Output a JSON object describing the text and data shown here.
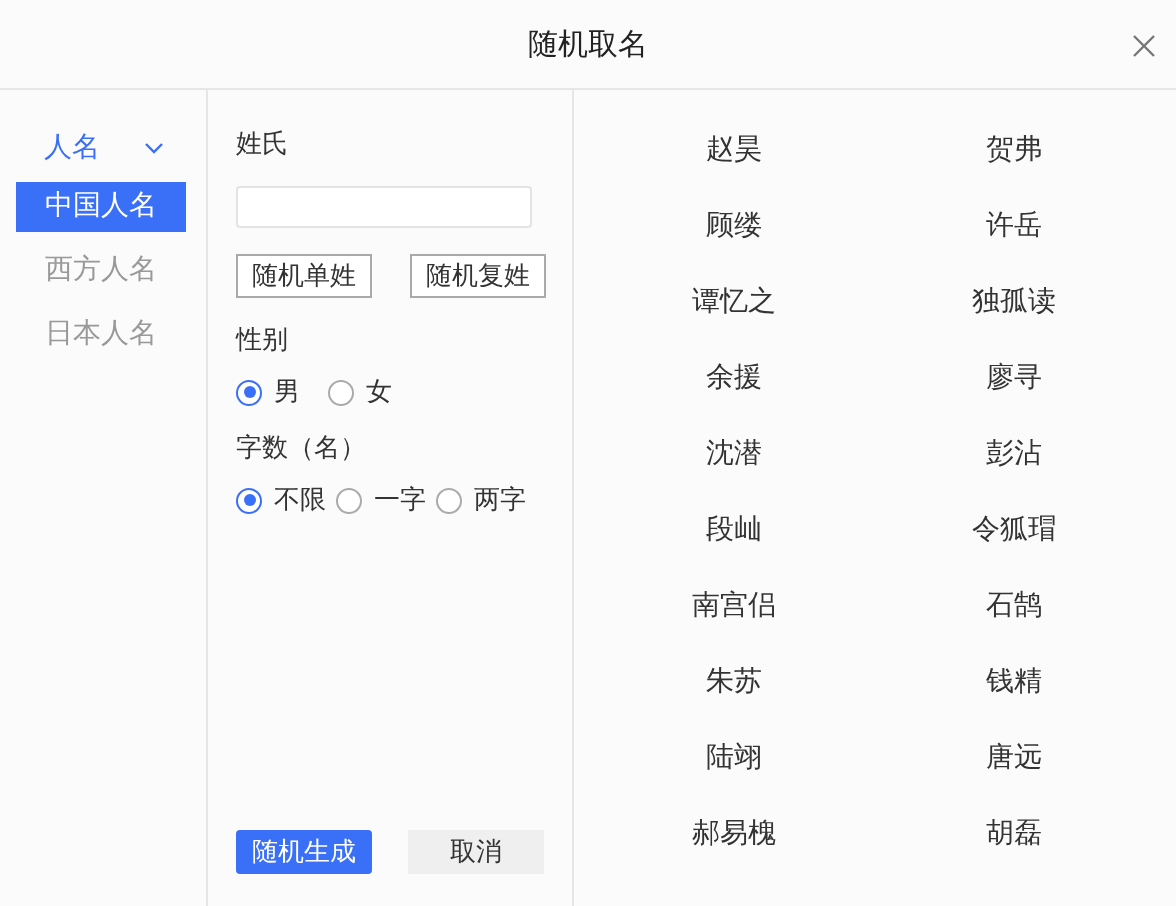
{
  "window": {
    "title": "随机取名"
  },
  "sidebar": {
    "category": {
      "label": "人名",
      "expanded": true
    },
    "items": [
      {
        "label": "中国人名",
        "selected": true
      },
      {
        "label": "西方人名",
        "selected": false
      },
      {
        "label": "日本人名",
        "selected": false
      }
    ]
  },
  "form": {
    "surname_label": "姓氏",
    "surname_buttons": [
      "随机单姓",
      "随机复姓"
    ],
    "gender_label": "性别",
    "gender_options": [
      {
        "label": "男",
        "selected": true
      },
      {
        "label": "女",
        "selected": false
      }
    ],
    "length_label": "字数（名）",
    "length_options": [
      {
        "label": "不限",
        "selected": true
      },
      {
        "label": "一字",
        "selected": false
      },
      {
        "label": "两字",
        "selected": false
      }
    ],
    "generate_button": "随机生成",
    "cancel_button": "取消"
  },
  "results": [
    [
      "赵昊",
      "贺弗"
    ],
    [
      "顾缕",
      "许岳"
    ],
    [
      "谭忆之",
      "独孤读"
    ],
    [
      "余援",
      "廖寻"
    ],
    [
      "沈潜",
      "彭沾"
    ],
    [
      "段屾",
      "令狐瑁"
    ],
    [
      "南宫侣",
      "石鹄"
    ],
    [
      "朱苏",
      "钱精"
    ],
    [
      "陆翊",
      "唐远"
    ],
    [
      "郝易槐",
      "胡磊"
    ]
  ]
}
